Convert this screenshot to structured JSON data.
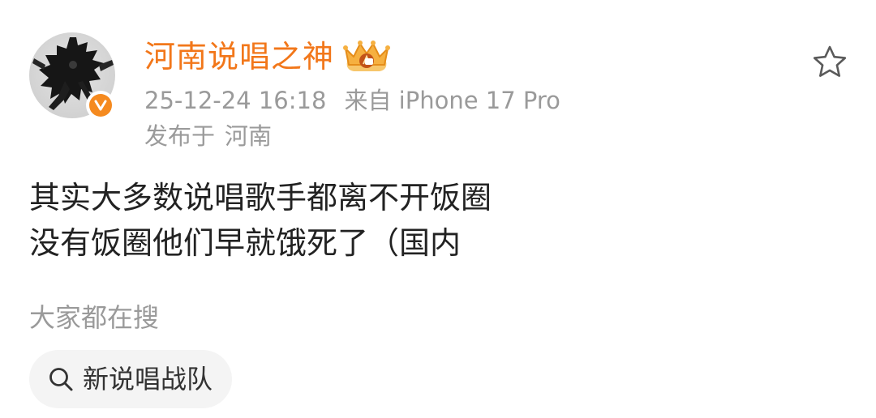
{
  "post": {
    "author": {
      "name": "河南说唱之神",
      "verified_icon": "verified-v-badge-icon",
      "badge_icon": "crown-badge-icon",
      "avatar_icon": "ink-figure-avatar"
    },
    "datetime": "25-12-24 16:18",
    "source": "来自 iPhone 17 Pro",
    "location_prefix": "发布于",
    "location": "河南",
    "content_lines": [
      "其实大多数说唱歌手都离不开饭圈",
      "没有饭圈他们早就饿死了（国内"
    ],
    "favorite_icon": "star-icon"
  },
  "hot_search": {
    "label": "大家都在搜",
    "chips": [
      {
        "icon": "search-icon",
        "text": "新说唱战队"
      }
    ]
  },
  "colors": {
    "accent_orange": "#f2771a",
    "verified_orange": "#f58a1f",
    "meta_gray": "#9a9a9a",
    "body_text": "#222222",
    "chip_bg": "#f4f4f4"
  }
}
